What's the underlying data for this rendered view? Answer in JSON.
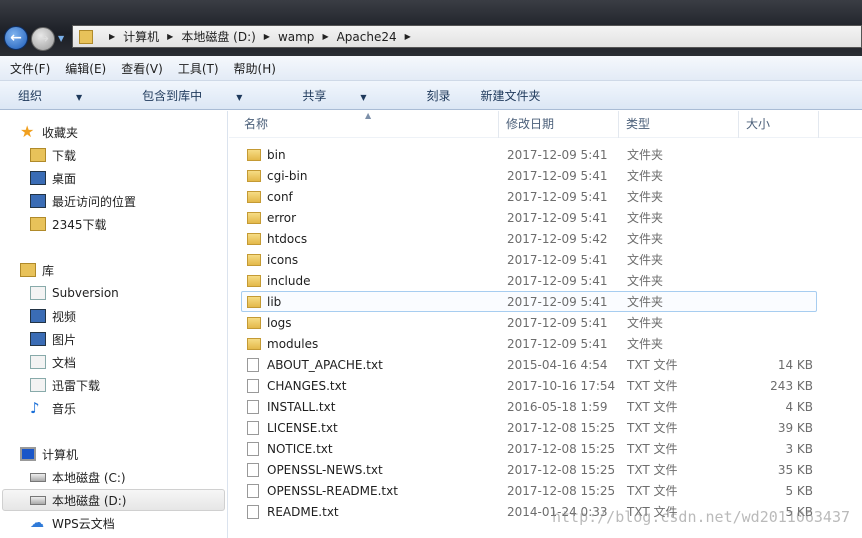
{
  "address": {
    "crumbs": [
      "计算机",
      "本地磁盘 (D:)",
      "wamp",
      "Apache24"
    ]
  },
  "menu": [
    "文件(F)",
    "编辑(E)",
    "查看(V)",
    "工具(T)",
    "帮助(H)"
  ],
  "toolbar": {
    "organize": "组织",
    "include": "包含到库中",
    "share": "共享",
    "burn": "刻录",
    "new_folder": "新建文件夹"
  },
  "nav": {
    "favorites": {
      "label": "收藏夹",
      "items": [
        "下载",
        "桌面",
        "最近访问的位置",
        "2345下载"
      ]
    },
    "libraries": {
      "label": "库",
      "items": [
        "Subversion",
        "视频",
        "图片",
        "文档",
        "迅雷下载",
        "音乐"
      ]
    },
    "computer": {
      "label": "计算机",
      "items": [
        "本地磁盘 (C:)",
        "本地磁盘 (D:)",
        "WPS云文档"
      ],
      "selected": "本地磁盘 (D:)"
    }
  },
  "columns": {
    "name": "名称",
    "date": "修改日期",
    "type": "类型",
    "size": "大小"
  },
  "files": [
    {
      "name": "bin",
      "date": "2017-12-09 5:41",
      "type": "文件夹",
      "size": "",
      "icon": "folder"
    },
    {
      "name": "cgi-bin",
      "date": "2017-12-09 5:41",
      "type": "文件夹",
      "size": "",
      "icon": "folder"
    },
    {
      "name": "conf",
      "date": "2017-12-09 5:41",
      "type": "文件夹",
      "size": "",
      "icon": "folder"
    },
    {
      "name": "error",
      "date": "2017-12-09 5:41",
      "type": "文件夹",
      "size": "",
      "icon": "folder"
    },
    {
      "name": "htdocs",
      "date": "2017-12-09 5:42",
      "type": "文件夹",
      "size": "",
      "icon": "folder"
    },
    {
      "name": "icons",
      "date": "2017-12-09 5:41",
      "type": "文件夹",
      "size": "",
      "icon": "folder"
    },
    {
      "name": "include",
      "date": "2017-12-09 5:41",
      "type": "文件夹",
      "size": "",
      "icon": "folder"
    },
    {
      "name": "lib",
      "date": "2017-12-09 5:41",
      "type": "文件夹",
      "size": "",
      "icon": "folder",
      "hover": true
    },
    {
      "name": "logs",
      "date": "2017-12-09 5:41",
      "type": "文件夹",
      "size": "",
      "icon": "folder"
    },
    {
      "name": "modules",
      "date": "2017-12-09 5:41",
      "type": "文件夹",
      "size": "",
      "icon": "folder"
    },
    {
      "name": "ABOUT_APACHE.txt",
      "date": "2015-04-16 4:54",
      "type": "TXT 文件",
      "size": "14 KB",
      "icon": "txt"
    },
    {
      "name": "CHANGES.txt",
      "date": "2017-10-16 17:54",
      "type": "TXT 文件",
      "size": "243 KB",
      "icon": "txt"
    },
    {
      "name": "INSTALL.txt",
      "date": "2016-05-18 1:59",
      "type": "TXT 文件",
      "size": "4 KB",
      "icon": "txt"
    },
    {
      "name": "LICENSE.txt",
      "date": "2017-12-08 15:25",
      "type": "TXT 文件",
      "size": "39 KB",
      "icon": "txt"
    },
    {
      "name": "NOTICE.txt",
      "date": "2017-12-08 15:25",
      "type": "TXT 文件",
      "size": "3 KB",
      "icon": "txt"
    },
    {
      "name": "OPENSSL-NEWS.txt",
      "date": "2017-12-08 15:25",
      "type": "TXT 文件",
      "size": "35 KB",
      "icon": "txt"
    },
    {
      "name": "OPENSSL-README.txt",
      "date": "2017-12-08 15:25",
      "type": "TXT 文件",
      "size": "5 KB",
      "icon": "txt"
    },
    {
      "name": "README.txt",
      "date": "2014-01-24 0:33",
      "type": "TXT 文件",
      "size": "5 KB",
      "icon": "txt"
    }
  ],
  "watermark": "http://blog.csdn.net/wd2011063437"
}
